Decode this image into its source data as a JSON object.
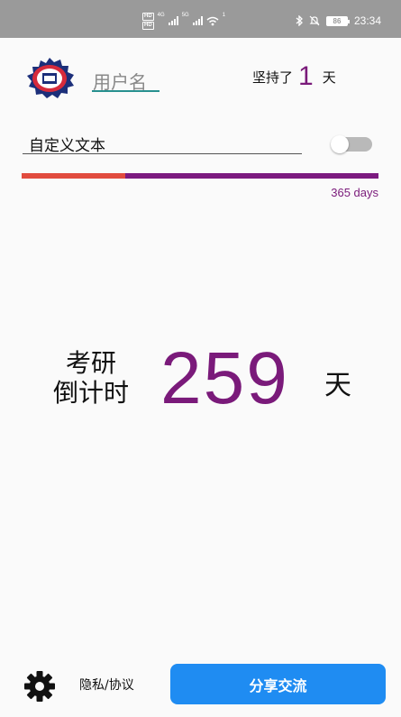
{
  "status_bar": {
    "hd_top": "HD",
    "hd_bottom": "HD",
    "net1": "4G",
    "net2": "5G",
    "wifi_sub": "1",
    "battery": "86",
    "time": "23:34"
  },
  "header": {
    "username_placeholder": "用户名",
    "persist_prefix": "坚持了",
    "persist_days": "1",
    "persist_suffix": "天"
  },
  "custom": {
    "text": "自定义文本",
    "toggle_on": false
  },
  "progress": {
    "fraction": 0.29,
    "label": "365 days"
  },
  "countdown": {
    "label_line1": "考研",
    "label_line2": "倒计时",
    "days": "259",
    "unit": "天"
  },
  "footer": {
    "privacy_label": "隐私/协议",
    "share_label": "分享交流"
  },
  "colors": {
    "accent_purple": "#7a1a7a",
    "progress_red": "#e14b3e",
    "share_blue": "#1f8cf2",
    "underline_teal": "#27908f"
  }
}
